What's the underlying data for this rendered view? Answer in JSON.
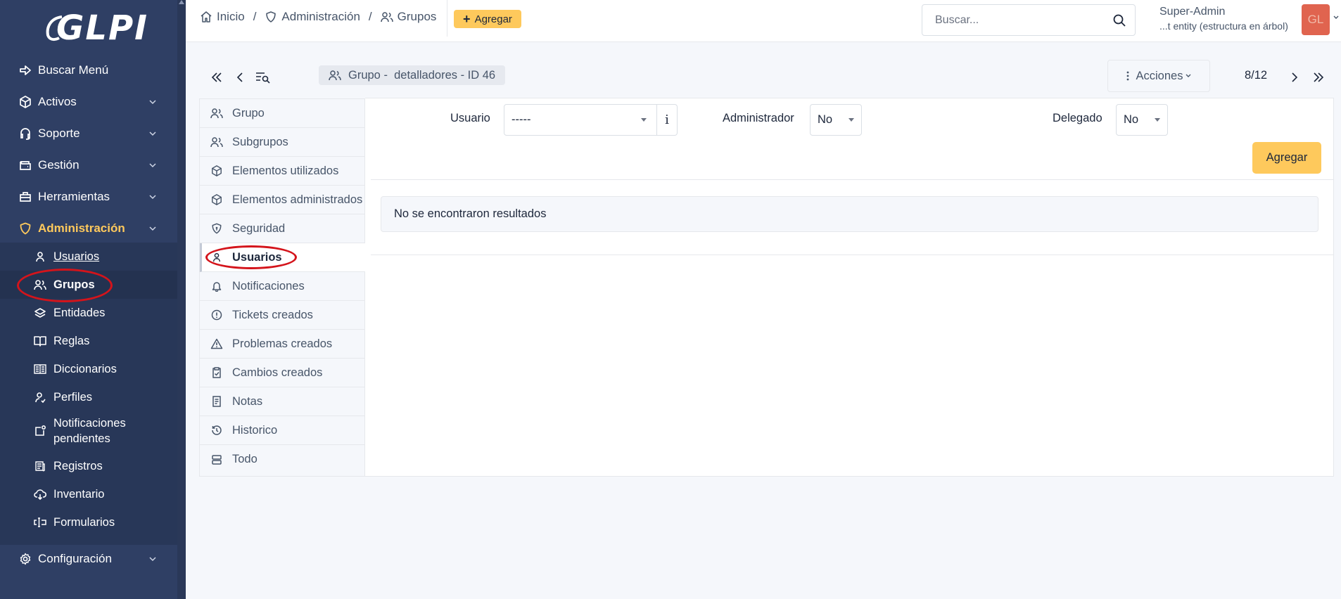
{
  "brand": {
    "logo_text": "GLPI"
  },
  "sidebar": {
    "menu": [
      {
        "label": "Buscar Menú",
        "icon": "arrow-right-icon"
      },
      {
        "label": "Activos",
        "icon": "cube-icon"
      },
      {
        "label": "Soporte",
        "icon": "headset-icon"
      },
      {
        "label": "Gestión",
        "icon": "wallet-icon"
      },
      {
        "label": "Herramientas",
        "icon": "briefcase-icon"
      },
      {
        "label": "Administración",
        "icon": "shield-icon"
      },
      {
        "label": "Configuración",
        "icon": "gear-icon"
      }
    ],
    "admin_submenu": [
      {
        "label": "Usuarios",
        "icon": "user-icon"
      },
      {
        "label": "Grupos",
        "icon": "users-icon"
      },
      {
        "label": "Entidades",
        "icon": "layers-icon"
      },
      {
        "label": "Reglas",
        "icon": "book-icon"
      },
      {
        "label": "Diccionarios",
        "icon": "book-open-icon"
      },
      {
        "label": "Perfiles",
        "icon": "user-check-icon"
      },
      {
        "label_line1": "Notificaciones",
        "label_line2": "pendientes",
        "icon": "notification-icon"
      },
      {
        "label": "Registros",
        "icon": "news-icon"
      },
      {
        "label": "Inventario",
        "icon": "cloud-download-icon"
      },
      {
        "label": "Formularios",
        "icon": "forms-icon"
      }
    ],
    "active_color": "#fec95c",
    "background": "#2f3f64"
  },
  "header": {
    "breadcrumb": [
      "Inicio",
      "Administración",
      "Grupos"
    ],
    "add_button": "Agregar",
    "search_placeholder": "Buscar...",
    "user_name": "Super-Admin",
    "user_entity": "...t entity (estructura en árbol)",
    "avatar_initials": "GL"
  },
  "toolbar": {
    "item_title": "Grupo -  detalladores - ID 46",
    "actions_label": "Acciones",
    "pager": "8/12"
  },
  "tabs": [
    {
      "label": "Grupo",
      "icon": "users-icon"
    },
    {
      "label": "Subgrupos",
      "icon": "users-icon"
    },
    {
      "label": "Elementos utilizados",
      "icon": "cube-icon"
    },
    {
      "label": "Elementos administrados",
      "icon": "cube-icon"
    },
    {
      "label": "Seguridad",
      "icon": "shield-lock-icon"
    },
    {
      "label": "Usuarios",
      "icon": "user-icon"
    },
    {
      "label": "Notificaciones",
      "icon": "bell-icon"
    },
    {
      "label": "Tickets creados",
      "icon": "alert-circle-icon"
    },
    {
      "label": "Problemas creados",
      "icon": "alert-triangle-icon"
    },
    {
      "label": "Cambios creados",
      "icon": "clipboard-check-icon"
    },
    {
      "label": "Notas",
      "icon": "notes-icon"
    },
    {
      "label": "Historico",
      "icon": "history-icon"
    },
    {
      "label": "Todo",
      "icon": "stack-icon"
    }
  ],
  "form": {
    "usuario_label": "Usuario",
    "usuario_value": "-----",
    "info_glyph": "i",
    "administrador_label": "Administrador",
    "administrador_value": "No",
    "delegado_label": "Delegado",
    "delegado_value": "No",
    "submit_label": "Agregar"
  },
  "results": {
    "empty_message": "No se encontraron resultados"
  },
  "accent": "#fec95c",
  "highlight_color": "#d4141b"
}
